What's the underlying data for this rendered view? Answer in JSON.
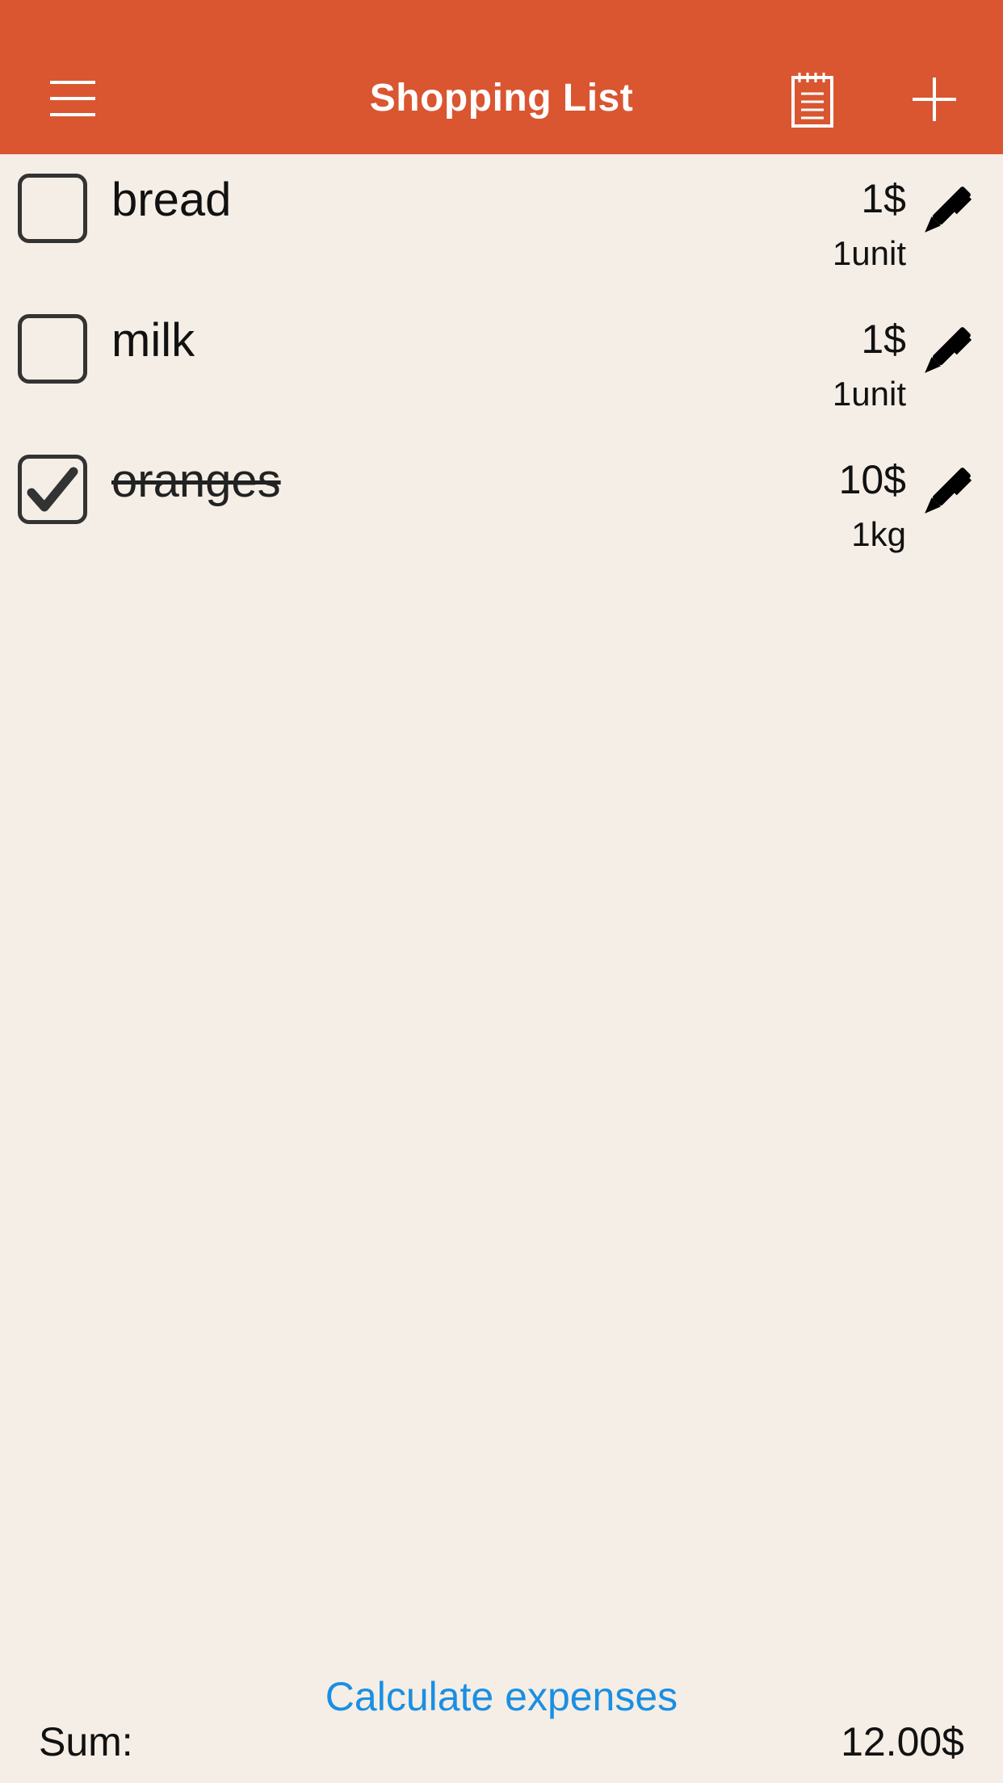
{
  "header": {
    "title": "Shopping List",
    "menu_icon": "hamburger-icon",
    "notes_icon": "notepad-icon",
    "add_icon": "plus-icon",
    "background": "#d95631"
  },
  "items": [
    {
      "name": "bread",
      "price": "1$",
      "quantity": "1unit",
      "checked": false
    },
    {
      "name": "milk",
      "price": "1$",
      "quantity": "1unit",
      "checked": false
    },
    {
      "name": "oranges",
      "price": "10$",
      "quantity": "1kg",
      "checked": true
    }
  ],
  "footer": {
    "calculate_label": "Calculate expenses",
    "sum_label": "Sum:",
    "sum_value": "12.00$",
    "link_color": "#1a8fe3"
  }
}
